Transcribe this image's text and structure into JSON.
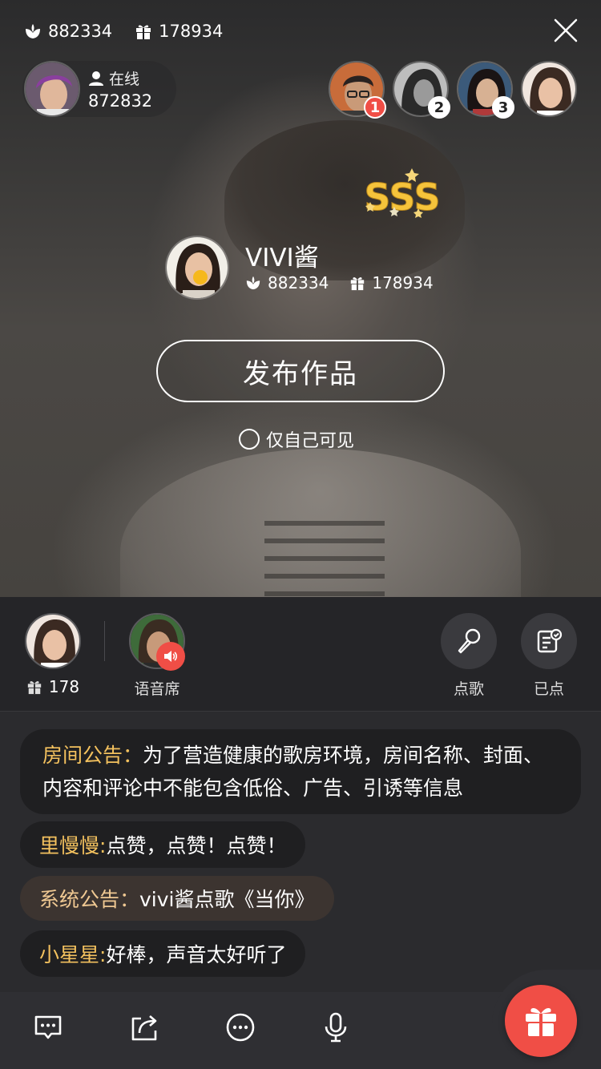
{
  "top_stats": {
    "likes": "882334",
    "gifts": "178934"
  },
  "anchor": {
    "online_label": "在线",
    "online_count": "872832"
  },
  "ranking": [
    {
      "rank": "1",
      "badge_color": "#f04e46",
      "skin": "#c99a78",
      "hair": "#2a2220"
    },
    {
      "rank": "2",
      "badge_color": "#ffffff",
      "skin": "#9a9a9a",
      "hair": "#2a2a2a"
    },
    {
      "rank": "3",
      "badge_color": "#ffffff",
      "skin": "#c9a58a",
      "hair": "#1a1414"
    },
    {
      "rank": "",
      "badge_color": "",
      "skin": "#e2b89c",
      "hair": "#3b2a22"
    }
  ],
  "grade": "SSS",
  "performer": {
    "name": "VIVI酱",
    "likes": "882334",
    "gifts": "178934"
  },
  "publish_label": "发布作品",
  "private_label": "仅自己可见",
  "seats": {
    "host_gift_count": "178",
    "voice_seat_label": "语音席",
    "song_request_label": "点歌",
    "requested_label": "已点"
  },
  "chat": [
    {
      "who": "房间公告：",
      "text": "为了营造健康的歌房环境，房间名称、封面、内容和评论中不能包含低俗、广告、引诱等信息",
      "type": "notice"
    },
    {
      "who": "里慢慢:",
      "text": " 点赞，点赞！点赞！",
      "type": "user"
    },
    {
      "who": "系统公告：",
      "text": "vivi酱点歌《当你》",
      "type": "system"
    },
    {
      "who": "小星星:",
      "text": " 好棒，声音太好听了",
      "type": "user"
    }
  ],
  "colors": {
    "accent": "#f04e46",
    "name_gold": "#f3c15e",
    "background": "#1c1c1f"
  }
}
